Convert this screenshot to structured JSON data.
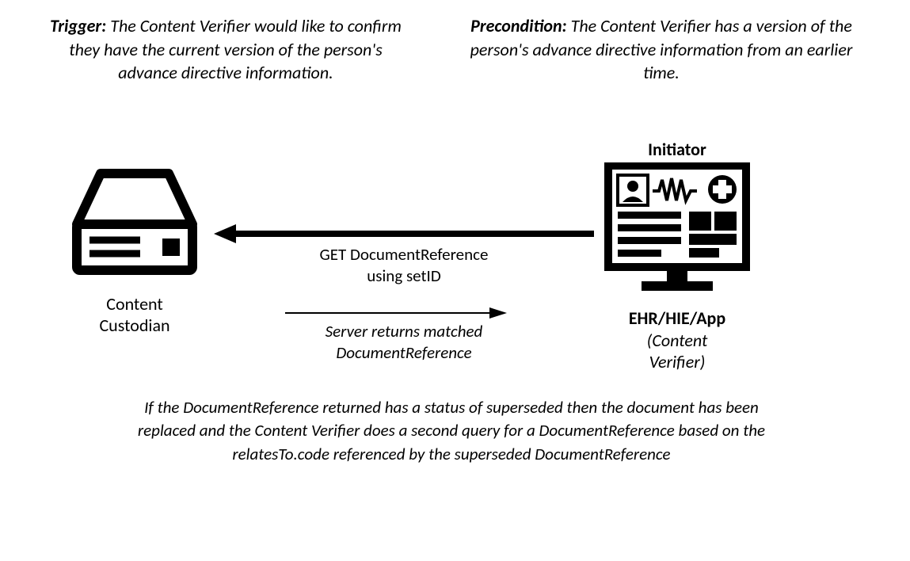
{
  "trigger": {
    "label": "Trigger:",
    "text": "The Content Verifier would like to confirm they have the current version of the person's advance directive information."
  },
  "precondition": {
    "label": "Precondition:",
    "text": "The Content Verifier has a version of the person's advance directive information from an earlier time."
  },
  "custodian_label_1": "Content",
  "custodian_label_2": "Custodian",
  "initiator_label": "Initiator",
  "ehr": {
    "main": "EHR/HIE/App",
    "sub1": "(Content",
    "sub2": "Verifier)"
  },
  "arrow1": {
    "line1": "GET DocumentReference",
    "line2": "using setID"
  },
  "arrow2": {
    "line1": "Server returns matched",
    "line2": "DocumentReference"
  },
  "bottom_note": "If the DocumentReference returned has a status of superseded then the document has been replaced and the Content Verifier does a second query for a DocumentReference based on the relatesTo.code referenced by the superseded DocumentReference"
}
